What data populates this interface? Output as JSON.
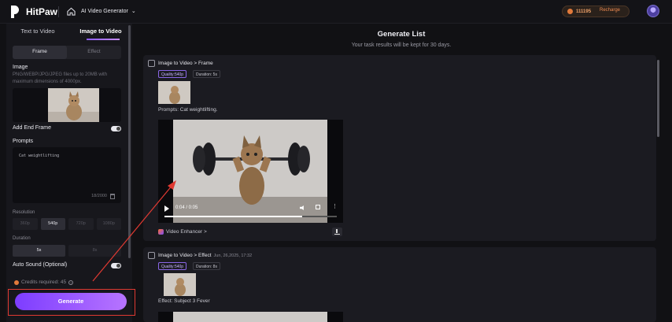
{
  "header": {
    "brand": "HitPaw",
    "nav_title": "AI Video Generator",
    "credits": "111195",
    "recharge": "Recharge"
  },
  "sidebar": {
    "tabs": [
      "Text to Video",
      "Image to Video"
    ],
    "mode_tabs": [
      "Frame",
      "Effect"
    ],
    "image_label": "Image",
    "image_hint": "PNG/WEBP/JPG/JPEG files up to 20MB with maximum dimensions of 4000px.",
    "end_frame_label": "Add End Frame",
    "prompts_label": "Prompts",
    "prompt_value": "Cat weightlifting",
    "prompt_counter": "18/2000",
    "resolution_label": "Resolution",
    "resolutions": [
      "360p",
      "540p",
      "720p",
      "1080p"
    ],
    "duration_label": "Duration",
    "durations": [
      "5s",
      "8s"
    ],
    "auto_sound_label": "Auto Sound (Optional)",
    "credits_required": "Credits required: 45",
    "generate_label": "Generate"
  },
  "main": {
    "title": "Generate List",
    "subtitle": "Your task results will be kept for 30 days.",
    "cards": [
      {
        "title": "Image to Video > Frame",
        "date": "",
        "quality": "Quality:540p",
        "duration": "Duration: 5s",
        "prompt": "Prompts:  Cat weightlifting.",
        "time": "0:04 / 0:05",
        "progress": 0.8,
        "enhancer": "Video Enhancer >"
      },
      {
        "title": "Image to Video > Effect",
        "date": "Jun, 26,2025, 17:32",
        "quality": "Quality:540p",
        "duration": "Duration: 8s",
        "prompt": "Effect: Subject 3 Fever"
      }
    ]
  },
  "colors": {
    "accent_purple": "#8c5cff",
    "recharge_orange": "#f08b52",
    "annotation_red": "#e03a32"
  }
}
